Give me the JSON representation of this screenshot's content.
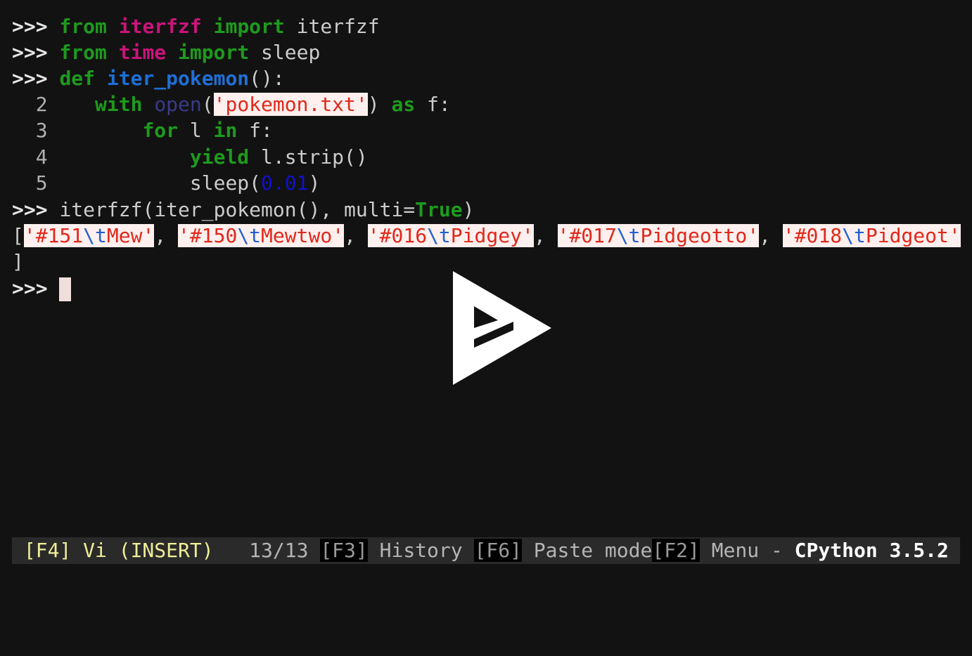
{
  "prompt": ">>>",
  "code": {
    "l1": {
      "kw_from": "from",
      "module": "iterfzf",
      "kw_import": "import",
      "name": "iterfzf"
    },
    "l2": {
      "kw_from": "from",
      "module": "time",
      "kw_import": "import",
      "name": "sleep"
    },
    "l3": {
      "kw_def": "def",
      "fn_name": "iter_pokemon",
      "rest": "():"
    },
    "l4": {
      "num": "2",
      "kw_with": "with",
      "builtin_open": "open",
      "paren_open": "(",
      "str": "'pokemon.txt'",
      "paren_close": ")",
      "kw_as": "as",
      "rest": " f:"
    },
    "l5": {
      "num": "3",
      "kw_for": "for",
      "mid": " l ",
      "kw_in": "in",
      "rest": " f:"
    },
    "l6": {
      "num": "4",
      "kw_yield": "yield",
      "rest": " l.strip()"
    },
    "l7": {
      "num": "5",
      "call": "sleep(",
      "number": "0.01",
      "close": ")"
    },
    "l8": {
      "call": "iterfzf(iter_pokemon(), multi=",
      "kw_true": "True",
      "close": ")"
    }
  },
  "output": {
    "open_bracket": "[",
    "items": [
      {
        "head": "'#151",
        "esc": "\\t",
        "tail": "Mew'"
      },
      {
        "head": "'#150",
        "esc": "\\t",
        "tail": "Mewtwo'"
      },
      {
        "head": "'#016",
        "esc": "\\t",
        "tail": "Pidgey'"
      },
      {
        "head": "'#017",
        "esc": "\\t",
        "tail": "Pidgeotto'"
      },
      {
        "head": "'#018",
        "esc": "\\t",
        "tail": "Pidgeot'"
      }
    ],
    "separator": ",",
    "close_bracket": "]"
  },
  "toolbar": {
    "mode": "[F4] Vi (INSERT)",
    "count": "13/13",
    "f3_key": "[F3]",
    "f3_label": "History",
    "f6_key": "[F6]",
    "f6_label": "Paste mode",
    "f2_key": "[F2]",
    "f2_label": "Menu",
    "dash": "-",
    "version": "CPython 3.5.2"
  },
  "overlay": {
    "icon": "play-logo-icon"
  },
  "colors": {
    "background": "#121212",
    "keyword": "#1e9a1e",
    "module": "#c8157a",
    "function": "#1e6fd6",
    "string": "#e0281b",
    "string_bg": "#fdf0ee",
    "number": "#1010d0",
    "toolbar_bg": "#2a2a2a",
    "mode": "#eeee99"
  }
}
